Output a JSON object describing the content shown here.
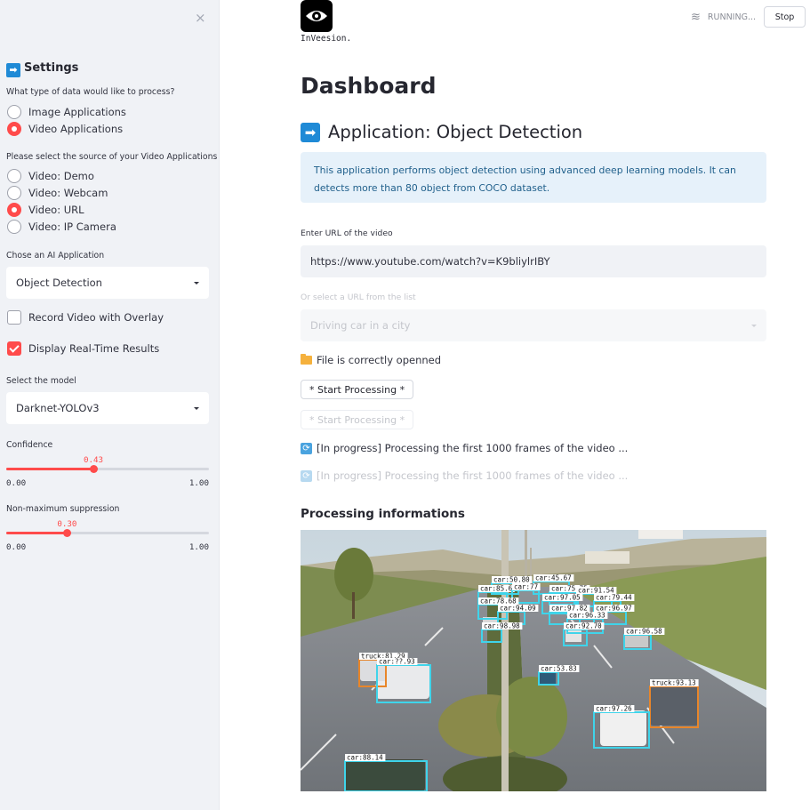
{
  "sidebar": {
    "close_label": "×",
    "heading": "Settings",
    "data_type_question": "What type of data would like to process?",
    "data_types": [
      {
        "label": "Image Applications",
        "selected": false
      },
      {
        "label": "Video Applications",
        "selected": true
      }
    ],
    "source_question": "Please select the source of your Video Applications",
    "sources": [
      {
        "label": "Video: Demo",
        "selected": false
      },
      {
        "label": "Video: Webcam",
        "selected": false
      },
      {
        "label": "Video: URL",
        "selected": true
      },
      {
        "label": "Video: IP Camera",
        "selected": false
      }
    ],
    "ai_app_label": "Chose an AI Application",
    "ai_app_value": "Object Detection",
    "record_video_label": "Record Video with Overlay",
    "record_video_checked": false,
    "display_results_label": "Display Real-Time Results",
    "display_results_checked": true,
    "model_label": "Select the model",
    "model_value": "Darknet-YOLOv3",
    "confidence": {
      "label": "Confidence",
      "value": 0.43,
      "value_text": "0.43",
      "min": "0.00",
      "max": "1.00"
    },
    "nms": {
      "label": "Non-maximum suppression",
      "value": 0.3,
      "value_text": "0.30",
      "min": "0.00",
      "max": "1.00"
    }
  },
  "header": {
    "logo_text": "InVeesion.",
    "status": "RUNNING...",
    "stop_label": "Stop"
  },
  "main": {
    "title": "Dashboard",
    "subtitle": "Application: Object Detection",
    "info": "This application performs object detection using advanced deep learning models. It can detects more than 80 object from COCO dataset.",
    "url_label": "Enter URL of the video",
    "url_value": "https://www.youtube.com/watch?v=K9bliylrIBY",
    "list_label": "Or select a URL from the list",
    "list_value": "Driving car in a city",
    "file_status": "File is correctly openned",
    "start_button": "* Start Processing *",
    "start_button_dim": "* Start Processing *",
    "progress": "[In progress] Processing the first 1000 frames of the video ...",
    "progress_dim": "[In progress] Processing the first 1000 frames of the video ...",
    "section_title": "Processing informations"
  },
  "detections": [
    {
      "label": "car:50.80",
      "cls": "car"
    },
    {
      "label": "car:45.67",
      "cls": "car"
    },
    {
      "label": "car:85.6",
      "cls": "car"
    },
    {
      "label": "car:77",
      "cls": "car"
    },
    {
      "label": "car:75.75",
      "cls": "car"
    },
    {
      "label": "car:91.54",
      "cls": "car"
    },
    {
      "label": "car:97.05",
      "cls": "car"
    },
    {
      "label": "car:79.44",
      "cls": "car"
    },
    {
      "label": "car:78.68",
      "cls": "car"
    },
    {
      "label": "car:97.82",
      "cls": "car"
    },
    {
      "label": "car:96.97",
      "cls": "car"
    },
    {
      "label": "car:94.09",
      "cls": "car"
    },
    {
      "label": "car:96.33",
      "cls": "car"
    },
    {
      "label": "car:98.98",
      "cls": "car"
    },
    {
      "label": "car:92.70",
      "cls": "car"
    },
    {
      "label": "car:96.58",
      "cls": "car"
    },
    {
      "label": "truck:81.29",
      "cls": "truck"
    },
    {
      "label": "car:??.93",
      "cls": "car"
    },
    {
      "label": "car:53.83",
      "cls": "car"
    },
    {
      "label": "truck:93.13",
      "cls": "truck"
    },
    {
      "label": "car:97.26",
      "cls": "car"
    },
    {
      "label": "car:88.14",
      "cls": "car"
    }
  ],
  "colors": {
    "accent": "#ff4b4b",
    "car_box": "#3fd4ea",
    "truck_box": "#e8862a",
    "info_bg": "#e6f1fa"
  }
}
